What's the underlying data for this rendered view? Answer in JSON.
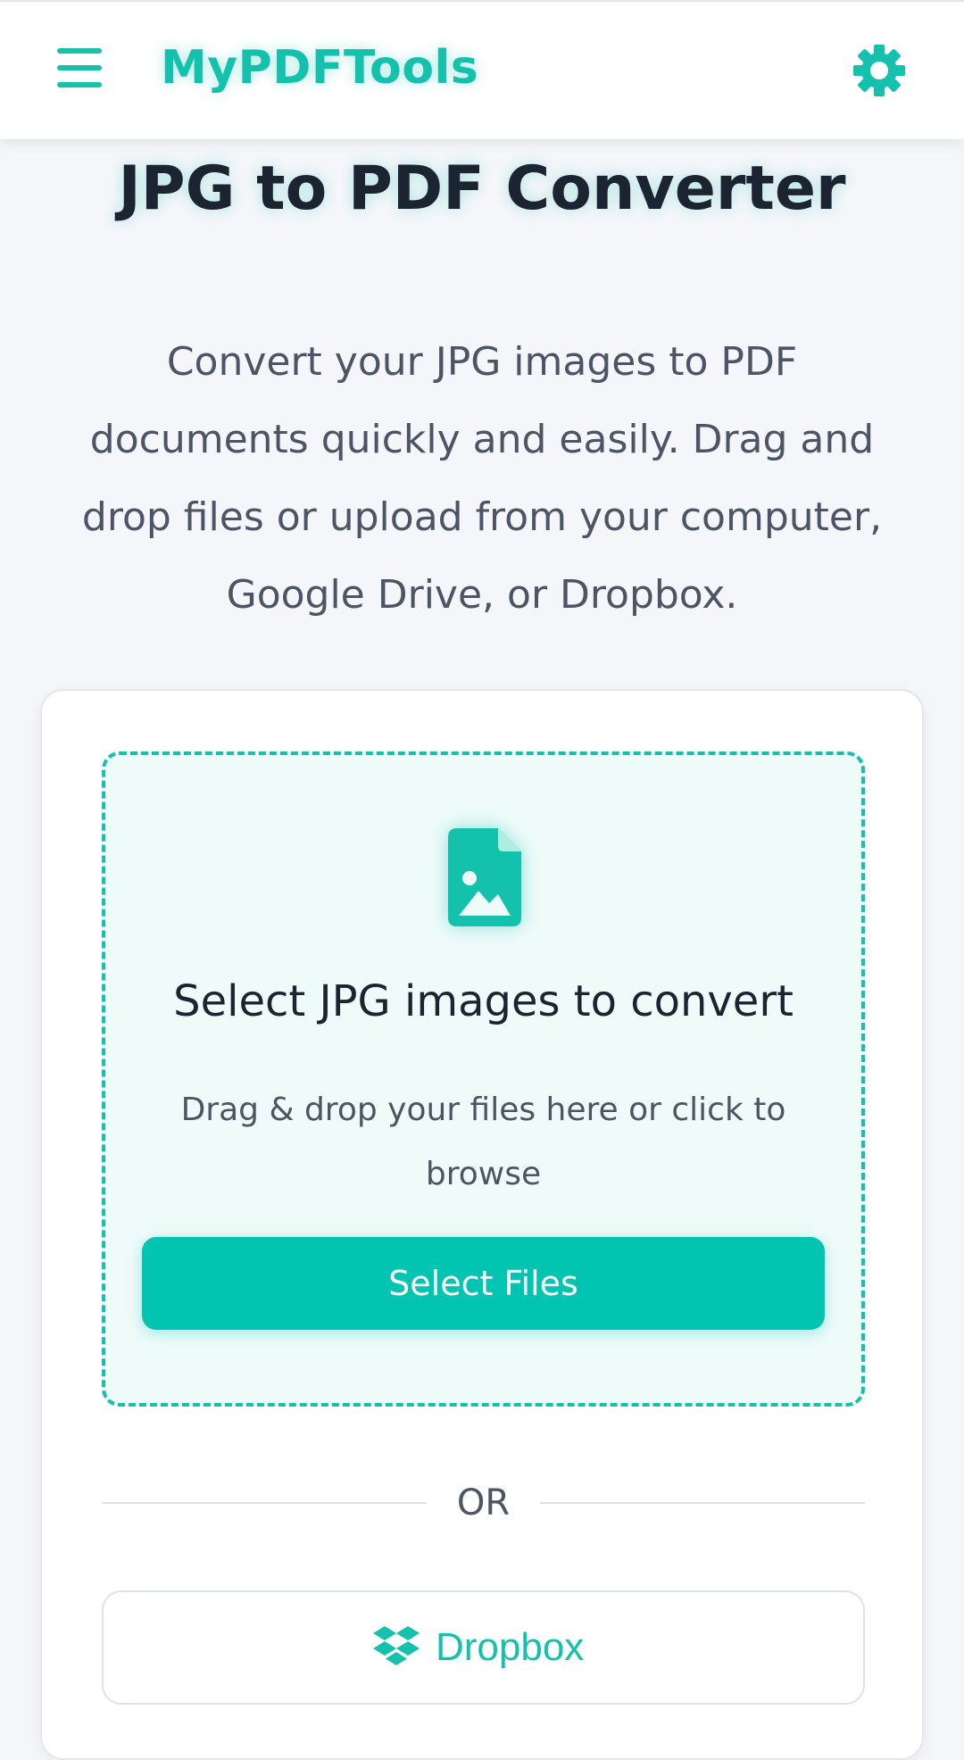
{
  "app": {
    "brand": "MyPDFTools",
    "accent_color": "#14c1ad",
    "icons": {
      "menu": "hamburger-menu-icon",
      "settings": "gear-icon",
      "upload": "image-file-icon",
      "dropbox": "dropbox-icon"
    }
  },
  "main": {
    "title": "JPG to PDF Converter",
    "intro": "Convert your JPG images to PDF documents quickly and easily. Drag and drop files or upload from your computer, Google Drive, or Dropbox."
  },
  "upload": {
    "title": "Select JPG images to convert",
    "subtitle": "Drag & drop your files here or click to browse",
    "button_label": "Select Files",
    "separator": "OR",
    "dropbox_label": "Dropbox"
  }
}
